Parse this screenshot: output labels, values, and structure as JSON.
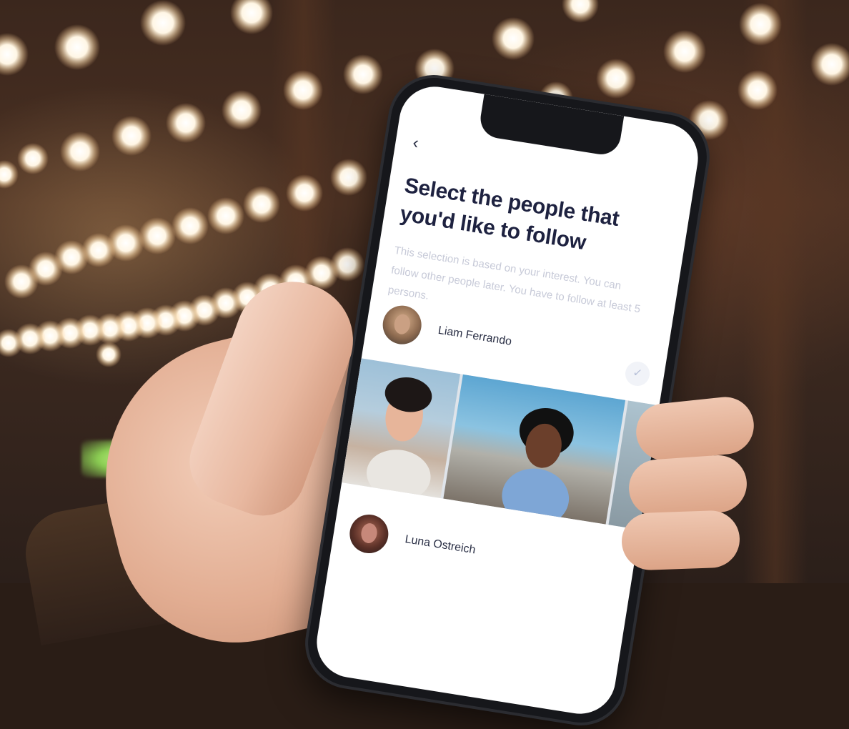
{
  "app": {
    "back_icon": "chevron-left-icon",
    "title": "Select the people that you'd like to follow",
    "subtitle": "This selection is based on your interest. You can follow other people later. You have to follow at least 5 persons."
  },
  "people": [
    {
      "name": "Liam Ferrando",
      "check_icon": "check-icon"
    },
    {
      "name": "Luna Ostreich"
    }
  ],
  "colors": {
    "title": "#1e2240",
    "subtitle": "#c7cad8",
    "name": "#2a2f45",
    "check": "#b6bfd8"
  }
}
